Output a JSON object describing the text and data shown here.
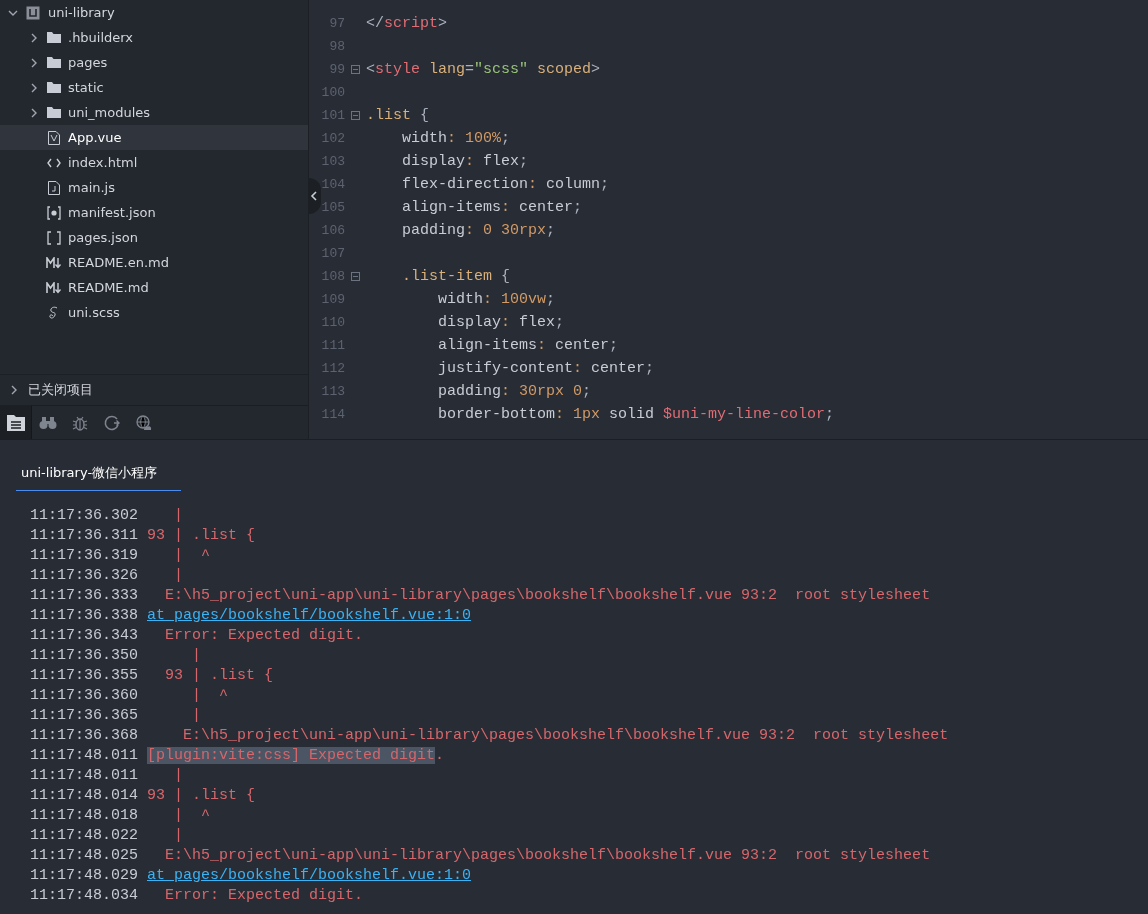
{
  "sidebar": {
    "project": {
      "name": "uni-library",
      "expanded": true,
      "children": [
        {
          "name": ".hbuilderx",
          "kind": "folder",
          "expanded": false,
          "selected": false
        },
        {
          "name": "pages",
          "kind": "folder",
          "expanded": false,
          "selected": false
        },
        {
          "name": "static",
          "kind": "folder",
          "expanded": false,
          "selected": false
        },
        {
          "name": "uni_modules",
          "kind": "folder",
          "expanded": false,
          "selected": false
        },
        {
          "name": "App.vue",
          "kind": "vue",
          "selected": true
        },
        {
          "name": "index.html",
          "kind": "html",
          "selected": false
        },
        {
          "name": "main.js",
          "kind": "js",
          "selected": false
        },
        {
          "name": "manifest.json",
          "kind": "settings",
          "selected": false
        },
        {
          "name": "pages.json",
          "kind": "json",
          "selected": false
        },
        {
          "name": "README.en.md",
          "kind": "md",
          "selected": false
        },
        {
          "name": "README.md",
          "kind": "md",
          "selected": false
        },
        {
          "name": "uni.scss",
          "kind": "scss",
          "selected": false
        }
      ]
    },
    "closed_projects": {
      "label": "已关闭项目",
      "expanded": false
    },
    "toolbar": [
      {
        "kind": "files",
        "selected": true
      },
      {
        "kind": "binoculars",
        "selected": false
      },
      {
        "kind": "bug",
        "selected": false
      },
      {
        "kind": "refresh",
        "selected": false
      },
      {
        "kind": "globe",
        "selected": false
      }
    ]
  },
  "editor": {
    "lines": [
      {
        "number": "97",
        "fold": false,
        "text": "</script>"
      },
      {
        "number": "98",
        "fold": false
      },
      {
        "number": "99",
        "fold": true,
        "text": "<style lang=\"scss\" scoped>"
      },
      {
        "number": "100",
        "fold": false
      },
      {
        "number": "101",
        "fold": true,
        "text": ".list {"
      },
      {
        "number": "102",
        "fold": false,
        "text": "    width: 100%;"
      },
      {
        "number": "103",
        "fold": false,
        "text": "    display: flex;"
      },
      {
        "number": "104",
        "fold": false,
        "text": "    flex-direction: column;"
      },
      {
        "number": "105",
        "fold": false,
        "text": "    align-items: center;"
      },
      {
        "number": "106",
        "fold": false,
        "text": "    padding: 0 30rpx;"
      },
      {
        "number": "107",
        "fold": false
      },
      {
        "number": "108",
        "fold": true,
        "text": "    .list-item {"
      },
      {
        "number": "109",
        "fold": false,
        "text": "        width: 100vw;"
      },
      {
        "number": "110",
        "fold": false,
        "text": "        display: flex;"
      },
      {
        "number": "111",
        "fold": false,
        "text": "        align-items: center;"
      },
      {
        "number": "112",
        "fold": false,
        "text": "        justify-content: center;"
      },
      {
        "number": "113",
        "fold": false,
        "text": "        padding: 30rpx 0;"
      },
      {
        "number": "114",
        "fold": false,
        "text": "        border-bottom: 1px solid $uni-my-line-color;"
      }
    ]
  },
  "console": {
    "tabs": [
      {
        "label": "uni-library-微信小程序",
        "selected": true
      }
    ],
    "lines": [
      {
        "time": "11:17:36.302",
        "kind": "error",
        "text": "   |"
      },
      {
        "time": "11:17:36.311",
        "kind": "error",
        "text": "93 | .list {"
      },
      {
        "time": "11:17:36.319",
        "kind": "error",
        "text": "   |  ^"
      },
      {
        "time": "11:17:36.326",
        "kind": "error",
        "text": "   |"
      },
      {
        "time": "11:17:36.333",
        "kind": "error",
        "text": "  E:\\h5_project\\uni-app\\uni-library\\pages\\bookshelf\\bookshelf.vue 93:2  root stylesheet"
      },
      {
        "time": "11:17:36.338",
        "kind": "link",
        "text": "at pages/bookshelf/bookshelf.vue:1:0"
      },
      {
        "time": "11:17:36.343",
        "kind": "error",
        "text": "  Error: Expected digit."
      },
      {
        "time": "11:17:36.350",
        "kind": "error",
        "text": "     |"
      },
      {
        "time": "11:17:36.355",
        "kind": "error",
        "text": "  93 | .list {"
      },
      {
        "time": "11:17:36.360",
        "kind": "error",
        "text": "     |  ^"
      },
      {
        "time": "11:17:36.365",
        "kind": "error",
        "text": "     |"
      },
      {
        "time": "11:17:36.368",
        "kind": "error",
        "text": "    E:\\h5_project\\uni-app\\uni-library\\pages\\bookshelf\\bookshelf.vue 93:2  root stylesheet"
      },
      {
        "time": "11:17:48.011",
        "kind": "error",
        "segments": [
          {
            "text": "[plugin:vite:css] Expected digit",
            "selected": true
          },
          {
            "text": ".",
            "selected": false
          }
        ]
      },
      {
        "time": "11:17:48.011",
        "kind": "error",
        "text": "   |"
      },
      {
        "time": "11:17:48.014",
        "kind": "error",
        "text": "93 | .list {"
      },
      {
        "time": "11:17:48.018",
        "kind": "error",
        "text": "   |  ^"
      },
      {
        "time": "11:17:48.022",
        "kind": "error",
        "text": "   |"
      },
      {
        "time": "11:17:48.025",
        "kind": "error",
        "text": "  E:\\h5_project\\uni-app\\uni-library\\pages\\bookshelf\\bookshelf.vue 93:2  root stylesheet"
      },
      {
        "time": "11:17:48.029",
        "kind": "link",
        "text": "at pages/bookshelf/bookshelf.vue:1:0"
      },
      {
        "time": "11:17:48.034",
        "kind": "error",
        "text": "  Error: Expected digit."
      }
    ]
  }
}
